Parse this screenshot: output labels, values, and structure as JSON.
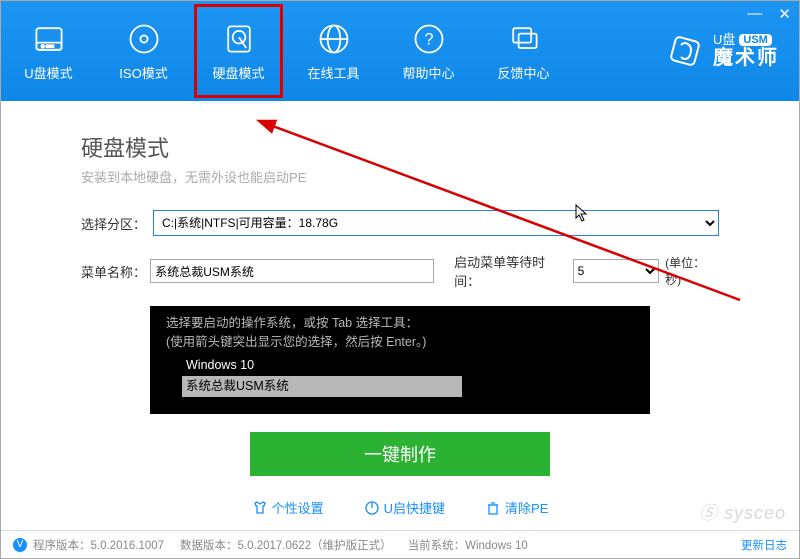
{
  "window": {
    "minimize": "—",
    "close": "✕"
  },
  "tabs": {
    "u": "U盘模式",
    "iso": "ISO模式",
    "hdd": "硬盘模式",
    "online": "在线工具",
    "help": "帮助中心",
    "feedback": "反馈中心"
  },
  "brand": {
    "small": "U盘",
    "usm": "USM",
    "big": "魔术师"
  },
  "page": {
    "title": "硬盘模式",
    "subtitle": "安装到本地硬盘，无需外设也能启动PE"
  },
  "form": {
    "partition_label": "选择分区：",
    "partition_value": "C:|系统|NTFS|可用容量：18.78G",
    "menuname_label": "菜单名称：",
    "menuname_value": "系统总裁USM系统",
    "bootwait_label": "启动菜单等待时间：",
    "bootwait_value": "5",
    "unit": "(单位：秒)"
  },
  "boot": {
    "hint1": "选择要启动的操作系统，或按 Tab 选择工具：",
    "hint2": "(使用箭头键突出显示您的选择，然后按 Enter。)",
    "os1": "Windows 10",
    "os2": "系统总裁USM系统"
  },
  "button": {
    "make": "一键制作"
  },
  "links": {
    "personal": "个性设置",
    "shortcut": "U启快捷键",
    "clear": "清除PE"
  },
  "status": {
    "badge": "V",
    "program": "程序版本：5.0.2016.1007",
    "data": "数据版本：5.0.2017.0622（维护版正式）",
    "os": "当前系统：Windows 10",
    "update": "更新日志"
  },
  "watermark": "Ⓢ sysceo"
}
